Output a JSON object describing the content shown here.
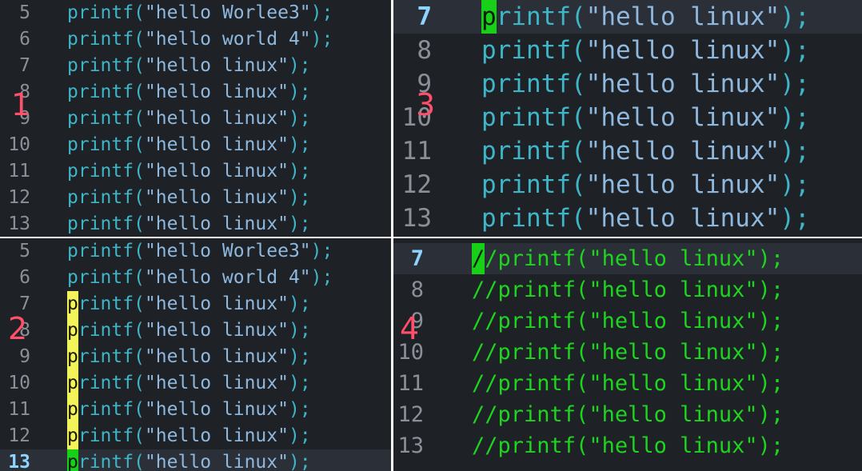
{
  "panes": [
    {
      "id": "pane1",
      "marker": "1",
      "lines": [
        {
          "num": "5",
          "pre": "printf(",
          "str": "\"hello Worlee3\"",
          "post": ");"
        },
        {
          "num": "6",
          "pre": "printf(",
          "str": "\"hello world 4\"",
          "post": ");"
        },
        {
          "num": "7",
          "pre": "printf(",
          "str": "\"hello linux\"",
          "post": ");"
        },
        {
          "num": "8",
          "pre": "printf(",
          "str": "\"hello linux\"",
          "post": ");"
        },
        {
          "num": "9",
          "pre": "printf(",
          "str": "\"hello linux\"",
          "post": ");"
        },
        {
          "num": "10",
          "pre": "printf(",
          "str": "\"hello linux\"",
          "post": ");"
        },
        {
          "num": "11",
          "pre": "printf(",
          "str": "\"hello linux\"",
          "post": ");"
        },
        {
          "num": "12",
          "pre": "printf(",
          "str": "\"hello linux\"",
          "post": ");"
        },
        {
          "num": "13",
          "pre": "printf(",
          "str": "\"hello linux\"",
          "post": ");"
        }
      ]
    },
    {
      "id": "pane2",
      "marker": "2",
      "lines": [
        {
          "num": "5",
          "pre": "printf(",
          "str": "\"hello Worlee3\"",
          "post": ");"
        },
        {
          "num": "6",
          "pre": "printf(",
          "str": "\"hello world 4\"",
          "post": ");"
        },
        {
          "num": "7",
          "cursor": "p",
          "cursor_color": "yellow",
          "pre": "rintf(",
          "str": "\"hello linux\"",
          "post": ");"
        },
        {
          "num": "8",
          "cursor": "p",
          "cursor_color": "yellow",
          "pre": "rintf(",
          "str": "\"hello linux\"",
          "post": ");"
        },
        {
          "num": "9",
          "cursor": "p",
          "cursor_color": "yellow",
          "pre": "rintf(",
          "str": "\"hello linux\"",
          "post": ");"
        },
        {
          "num": "10",
          "cursor": "p",
          "cursor_color": "yellow",
          "pre": "rintf(",
          "str": "\"hello linux\"",
          "post": ");"
        },
        {
          "num": "11",
          "cursor": "p",
          "cursor_color": "yellow",
          "pre": "rintf(",
          "str": "\"hello linux\"",
          "post": ");"
        },
        {
          "num": "12",
          "cursor": "p",
          "cursor_color": "yellow",
          "pre": "rintf(",
          "str": "\"hello linux\"",
          "post": ");"
        },
        {
          "num": "13",
          "current": true,
          "cursor": "p",
          "cursor_color": "green",
          "pre": "rintf(",
          "str": "\"hello linux\"",
          "post": ");"
        }
      ]
    },
    {
      "id": "pane3",
      "marker": "3",
      "lines": [
        {
          "num": "7",
          "current": true,
          "cursor": "p",
          "cursor_color": "green",
          "pre": "rintf(",
          "str": "\"hello linux\"",
          "post": ");"
        },
        {
          "num": "8",
          "pre": "printf(",
          "str": "\"hello linux\"",
          "post": ");"
        },
        {
          "num": "9",
          "pre": "printf(",
          "str": "\"hello linux\"",
          "post": ");"
        },
        {
          "num": "10",
          "pre": "printf(",
          "str": "\"hello linux\"",
          "post": ");"
        },
        {
          "num": "11",
          "pre": "printf(",
          "str": "\"hello linux\"",
          "post": ");"
        },
        {
          "num": "12",
          "pre": "printf(",
          "str": "\"hello linux\"",
          "post": ");"
        },
        {
          "num": "13",
          "pre": "printf(",
          "str": "\"hello linux\"",
          "post": ");"
        }
      ]
    },
    {
      "id": "pane4",
      "marker": "4",
      "comment": true,
      "lines": [
        {
          "num": "7",
          "current": true,
          "cursor": "/",
          "cursor_color": "green",
          "pre": "/printf(",
          "str": "\"hello linux\"",
          "post": ");"
        },
        {
          "num": "8",
          "pre": "//printf(",
          "str": "\"hello linux\"",
          "post": ");"
        },
        {
          "num": "9",
          "pre": "//printf(",
          "str": "\"hello linux\"",
          "post": ");"
        },
        {
          "num": "10",
          "pre": "//printf(",
          "str": "\"hello linux\"",
          "post": ");"
        },
        {
          "num": "11",
          "pre": "//printf(",
          "str": "\"hello linux\"",
          "post": ");"
        },
        {
          "num": "12",
          "pre": "//printf(",
          "str": "\"hello linux\"",
          "post": ");"
        },
        {
          "num": "13",
          "pre": "//printf(",
          "str": "\"hello linux\"",
          "post": ");"
        }
      ]
    }
  ],
  "colors": {
    "background": "#1e2227",
    "keyword": "#3fb5c8",
    "string": "#8fb8df",
    "line_number": "#8a8f98",
    "comment": "#1fd41f",
    "cursor_green": "#17d017",
    "cursor_yellow": "#f3f35a",
    "marker": "#ff4f6a"
  }
}
